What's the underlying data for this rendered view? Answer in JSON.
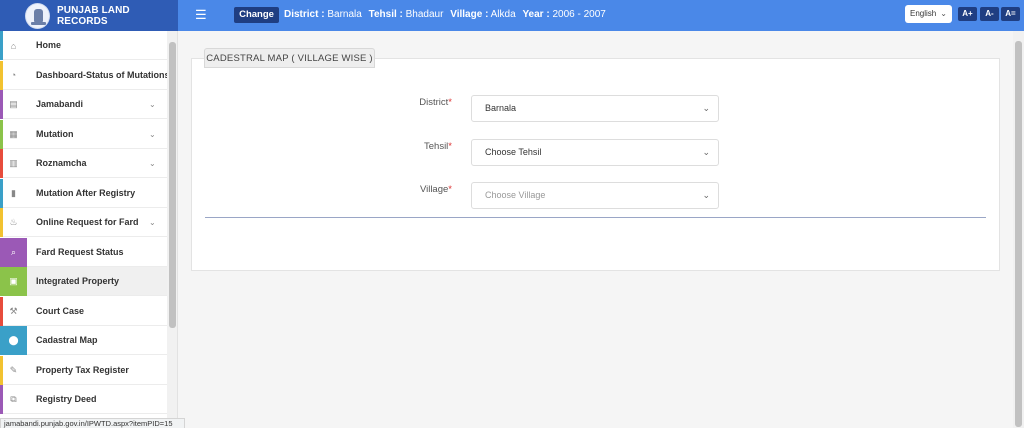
{
  "header": {
    "brand_title": "PUNJAB LAND RECORDS",
    "menu_icon": "☰",
    "change_label": "Change",
    "district_label": "District :",
    "district_value": "Barnala",
    "tehsil_label": "Tehsil :",
    "tehsil_value": "Bhadaur",
    "village_label": "Village :",
    "village_value": "Alkda",
    "year_label": "Year :",
    "year_value": "2006 - 2007",
    "language": "English",
    "font_increase": "A+",
    "font_decrease": "A-",
    "font_reset": "A="
  },
  "sidebar": {
    "items": [
      {
        "label": "Home",
        "icon": "home-icon",
        "glyph": "⌂",
        "color": "#3aa0c8",
        "caret": ""
      },
      {
        "label": "Dashboard-Status of Mutations",
        "icon": "dashboard-icon",
        "glyph": "◔",
        "color": "#f2c230",
        "caret": ""
      },
      {
        "label": "Jamabandi",
        "icon": "card-icon",
        "glyph": "▤",
        "color": "#9b59b6",
        "caret": "⌄"
      },
      {
        "label": "Mutation",
        "icon": "document-icon",
        "glyph": "▦",
        "color": "#8bc34a",
        "caret": "⌄"
      },
      {
        "label": "Roznamcha",
        "icon": "book-icon",
        "glyph": "▥",
        "color": "#e74c3c",
        "caret": "⌄"
      },
      {
        "label": "Mutation After Registry",
        "icon": "building-icon",
        "glyph": "▮",
        "color": "#3aa0c8",
        "caret": ""
      },
      {
        "label": "Online Request for Fard",
        "icon": "fire-icon",
        "glyph": "♨",
        "color": "#f2c230",
        "caret": "⌄"
      },
      {
        "label": "Fard Request Status",
        "icon": "search-icon",
        "glyph": "⌕",
        "color": "#9b59b6",
        "caret": ""
      },
      {
        "label": "Integrated Property",
        "icon": "property-icon",
        "glyph": "▣",
        "color": "#8bc34a",
        "caret": ""
      },
      {
        "label": "Court Case",
        "icon": "gavel-icon",
        "glyph": "⚒",
        "color": "#e74c3c",
        "caret": ""
      },
      {
        "label": "Cadastral Map",
        "icon": "map-marker-icon",
        "glyph": "⬤",
        "color": "#3aa0c8",
        "caret": ""
      },
      {
        "label": "Property Tax Register",
        "icon": "edit-icon",
        "glyph": "✎",
        "color": "#f2c230",
        "caret": ""
      },
      {
        "label": "Registry Deed",
        "icon": "copy-icon",
        "glyph": "⧉",
        "color": "#9b59b6",
        "caret": ""
      }
    ]
  },
  "status_url": "jamabandi.punjab.gov.in/IPWTD.aspx?itemPID=15",
  "main": {
    "section_title": "CADESTRAL MAP ( VILLAGE WISE )",
    "required_mark": "*",
    "fields": [
      {
        "label": "District",
        "value": "Barnala"
      },
      {
        "label": "Tehsil",
        "value": "Choose Tehsil"
      },
      {
        "label": "Village",
        "value": "Choose Village"
      }
    ]
  },
  "colors": {
    "header_bg": "#4a88e8",
    "brand_bg": "#2f5cb5",
    "button_bg": "#1f3e82"
  }
}
